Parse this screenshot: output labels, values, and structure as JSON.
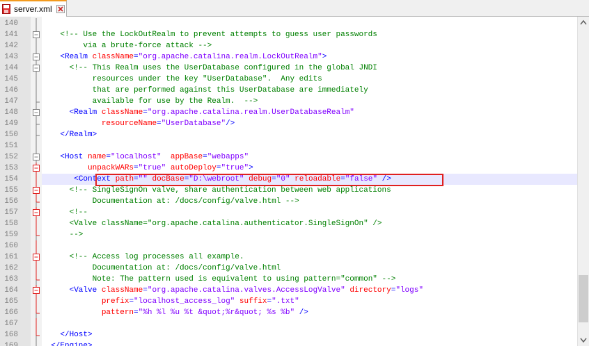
{
  "tab": {
    "filename": "server.xml",
    "file_icon": "floppy-disk-icon",
    "close_icon": "close-icon"
  },
  "editor": {
    "highlighted_line": 154,
    "lines": [
      {
        "n": "140",
        "fold": "line",
        "segs": []
      },
      {
        "n": "141",
        "fold": "box",
        "segs": [
          {
            "t": "    "
          },
          {
            "t": "<!-- Use the LockOutRealm to prevent attempts to guess user passwords",
            "c": "k-c"
          }
        ]
      },
      {
        "n": "142",
        "fold": "line",
        "segs": [
          {
            "t": "         "
          },
          {
            "t": "via a brute-force attack -->",
            "c": "k-c"
          }
        ]
      },
      {
        "n": "143",
        "fold": "box",
        "segs": [
          {
            "t": "    "
          },
          {
            "t": "<Realm ",
            "c": "k-t"
          },
          {
            "t": "className",
            "c": "k-a"
          },
          {
            "t": "=",
            "c": "k-p"
          },
          {
            "t": "\"org.apache.catalina.realm.LockOutRealm\"",
            "c": "k-v"
          },
          {
            "t": ">",
            "c": "k-t"
          }
        ]
      },
      {
        "n": "144",
        "fold": "box",
        "segs": [
          {
            "t": "      "
          },
          {
            "t": "<!-- This Realm uses the UserDatabase configured in the global JNDI",
            "c": "k-c"
          }
        ]
      },
      {
        "n": "145",
        "fold": "line",
        "segs": [
          {
            "t": "           "
          },
          {
            "t": "resources under the key \"UserDatabase\".  Any edits",
            "c": "k-c"
          }
        ]
      },
      {
        "n": "146",
        "fold": "line",
        "segs": [
          {
            "t": "           "
          },
          {
            "t": "that are performed against this UserDatabase are immediately",
            "c": "k-c"
          }
        ]
      },
      {
        "n": "147",
        "fold": "end",
        "segs": [
          {
            "t": "           "
          },
          {
            "t": "available for use by the Realm.  -->",
            "c": "k-c"
          }
        ]
      },
      {
        "n": "148",
        "fold": "box",
        "segs": [
          {
            "t": "      "
          },
          {
            "t": "<Realm ",
            "c": "k-t"
          },
          {
            "t": "className",
            "c": "k-a"
          },
          {
            "t": "=",
            "c": "k-p"
          },
          {
            "t": "\"org.apache.catalina.realm.UserDatabaseRealm\"",
            "c": "k-v"
          }
        ]
      },
      {
        "n": "149",
        "fold": "end",
        "segs": [
          {
            "t": "             "
          },
          {
            "t": "resourceName",
            "c": "k-a"
          },
          {
            "t": "=",
            "c": "k-p"
          },
          {
            "t": "\"UserDatabase\"",
            "c": "k-v"
          },
          {
            "t": "/>",
            "c": "k-t"
          }
        ]
      },
      {
        "n": "150",
        "fold": "end",
        "segs": [
          {
            "t": "    "
          },
          {
            "t": "</Realm>",
            "c": "k-t"
          }
        ]
      },
      {
        "n": "151",
        "fold": "line",
        "segs": []
      },
      {
        "n": "152",
        "fold": "box",
        "segs": [
          {
            "t": "    "
          },
          {
            "t": "<Host ",
            "c": "k-t"
          },
          {
            "t": "name",
            "c": "k-a"
          },
          {
            "t": "=",
            "c": "k-p"
          },
          {
            "t": "\"localhost\"",
            "c": "k-v"
          },
          {
            "t": "  "
          },
          {
            "t": "appBase",
            "c": "k-a"
          },
          {
            "t": "=",
            "c": "k-p"
          },
          {
            "t": "\"webapps\"",
            "c": "k-v"
          }
        ]
      },
      {
        "n": "153",
        "fold": "redbox",
        "segs": [
          {
            "t": "          "
          },
          {
            "t": "unpackWARs",
            "c": "k-a"
          },
          {
            "t": "=",
            "c": "k-p"
          },
          {
            "t": "\"true\"",
            "c": "k-v"
          },
          {
            "t": " "
          },
          {
            "t": "autoDeploy",
            "c": "k-a"
          },
          {
            "t": "=",
            "c": "k-p"
          },
          {
            "t": "\"true\"",
            "c": "k-v"
          },
          {
            "t": ">",
            "c": "k-t"
          }
        ]
      },
      {
        "n": "154",
        "fold": "redline",
        "segs": [
          {
            "t": "       "
          },
          {
            "t": "<Context ",
            "c": "k-t"
          },
          {
            "t": "path",
            "c": "k-a"
          },
          {
            "t": "=",
            "c": "k-p"
          },
          {
            "t": "\"\"",
            "c": "k-v"
          },
          {
            "t": " "
          },
          {
            "t": "docBase",
            "c": "k-a"
          },
          {
            "t": "=",
            "c": "k-p"
          },
          {
            "t": "\"D:\\webroot\"",
            "c": "k-v"
          },
          {
            "t": " "
          },
          {
            "t": "debug",
            "c": "k-a"
          },
          {
            "t": "=",
            "c": "k-p"
          },
          {
            "t": "\"0\"",
            "c": "k-v"
          },
          {
            "t": " "
          },
          {
            "t": "reloadable",
            "c": "k-a"
          },
          {
            "t": "=",
            "c": "k-p"
          },
          {
            "t": "\"false\"",
            "c": "k-v"
          },
          {
            "t": " />",
            "c": "k-t"
          }
        ]
      },
      {
        "n": "155",
        "fold": "redbox",
        "segs": [
          {
            "t": "      "
          },
          {
            "t": "<!-- SingleSignOn valve, share authentication between web applications",
            "c": "k-c"
          }
        ]
      },
      {
        "n": "156",
        "fold": "redend",
        "segs": [
          {
            "t": "           "
          },
          {
            "t": "Documentation at: /docs/config/valve.html -->",
            "c": "k-c"
          }
        ]
      },
      {
        "n": "157",
        "fold": "redbox",
        "segs": [
          {
            "t": "      "
          },
          {
            "t": "<!--",
            "c": "k-c"
          }
        ]
      },
      {
        "n": "158",
        "fold": "redline",
        "segs": [
          {
            "t": "      "
          },
          {
            "t": "<Valve className=\"org.apache.catalina.authenticator.SingleSignOn\" />",
            "c": "k-c"
          }
        ]
      },
      {
        "n": "159",
        "fold": "redend",
        "segs": [
          {
            "t": "      "
          },
          {
            "t": "-->",
            "c": "k-c"
          }
        ]
      },
      {
        "n": "160",
        "fold": "redline",
        "segs": []
      },
      {
        "n": "161",
        "fold": "redbox",
        "segs": [
          {
            "t": "      "
          },
          {
            "t": "<!-- Access log processes all example.",
            "c": "k-c"
          }
        ]
      },
      {
        "n": "162",
        "fold": "redline",
        "segs": [
          {
            "t": "           "
          },
          {
            "t": "Documentation at: /docs/config/valve.html",
            "c": "k-c"
          }
        ]
      },
      {
        "n": "163",
        "fold": "redend",
        "segs": [
          {
            "t": "           "
          },
          {
            "t": "Note: The pattern used is equivalent to using pattern=\"common\" -->",
            "c": "k-c"
          }
        ]
      },
      {
        "n": "164",
        "fold": "redbox",
        "segs": [
          {
            "t": "      "
          },
          {
            "t": "<Valve ",
            "c": "k-t"
          },
          {
            "t": "className",
            "c": "k-a"
          },
          {
            "t": "=",
            "c": "k-p"
          },
          {
            "t": "\"org.apache.catalina.valves.AccessLogValve\"",
            "c": "k-v"
          },
          {
            "t": " "
          },
          {
            "t": "directory",
            "c": "k-a"
          },
          {
            "t": "=",
            "c": "k-p"
          },
          {
            "t": "\"logs\"",
            "c": "k-v"
          }
        ]
      },
      {
        "n": "165",
        "fold": "redline",
        "segs": [
          {
            "t": "             "
          },
          {
            "t": "prefix",
            "c": "k-a"
          },
          {
            "t": "=",
            "c": "k-p"
          },
          {
            "t": "\"localhost_access_log\"",
            "c": "k-v"
          },
          {
            "t": " "
          },
          {
            "t": "suffix",
            "c": "k-a"
          },
          {
            "t": "=",
            "c": "k-p"
          },
          {
            "t": "\".txt\"",
            "c": "k-v"
          }
        ]
      },
      {
        "n": "166",
        "fold": "redend",
        "segs": [
          {
            "t": "             "
          },
          {
            "t": "pattern",
            "c": "k-a"
          },
          {
            "t": "=",
            "c": "k-p"
          },
          {
            "t": "\"%h %l %u %t &quot;%r&quot; %s %b\"",
            "c": "k-v"
          },
          {
            "t": " />",
            "c": "k-t"
          }
        ]
      },
      {
        "n": "167",
        "fold": "redline",
        "segs": []
      },
      {
        "n": "168",
        "fold": "redend",
        "segs": [
          {
            "t": "    "
          },
          {
            "t": "</Host>",
            "c": "k-t"
          }
        ]
      },
      {
        "n": "169",
        "fold": "end",
        "segs": [
          {
            "t": "  "
          },
          {
            "t": "</Engine>",
            "c": "k-t"
          }
        ]
      }
    ]
  },
  "colors": {
    "tab_accent": "#f39a1e",
    "highlight_box": "#e0201f",
    "fold_red": "#e0201f",
    "current_line": "#e8e8ff"
  },
  "scrollbar": {
    "up_icon": "scroll-up-arrow-icon",
    "down_icon": "scroll-down-arrow-icon",
    "position": 0.8
  }
}
